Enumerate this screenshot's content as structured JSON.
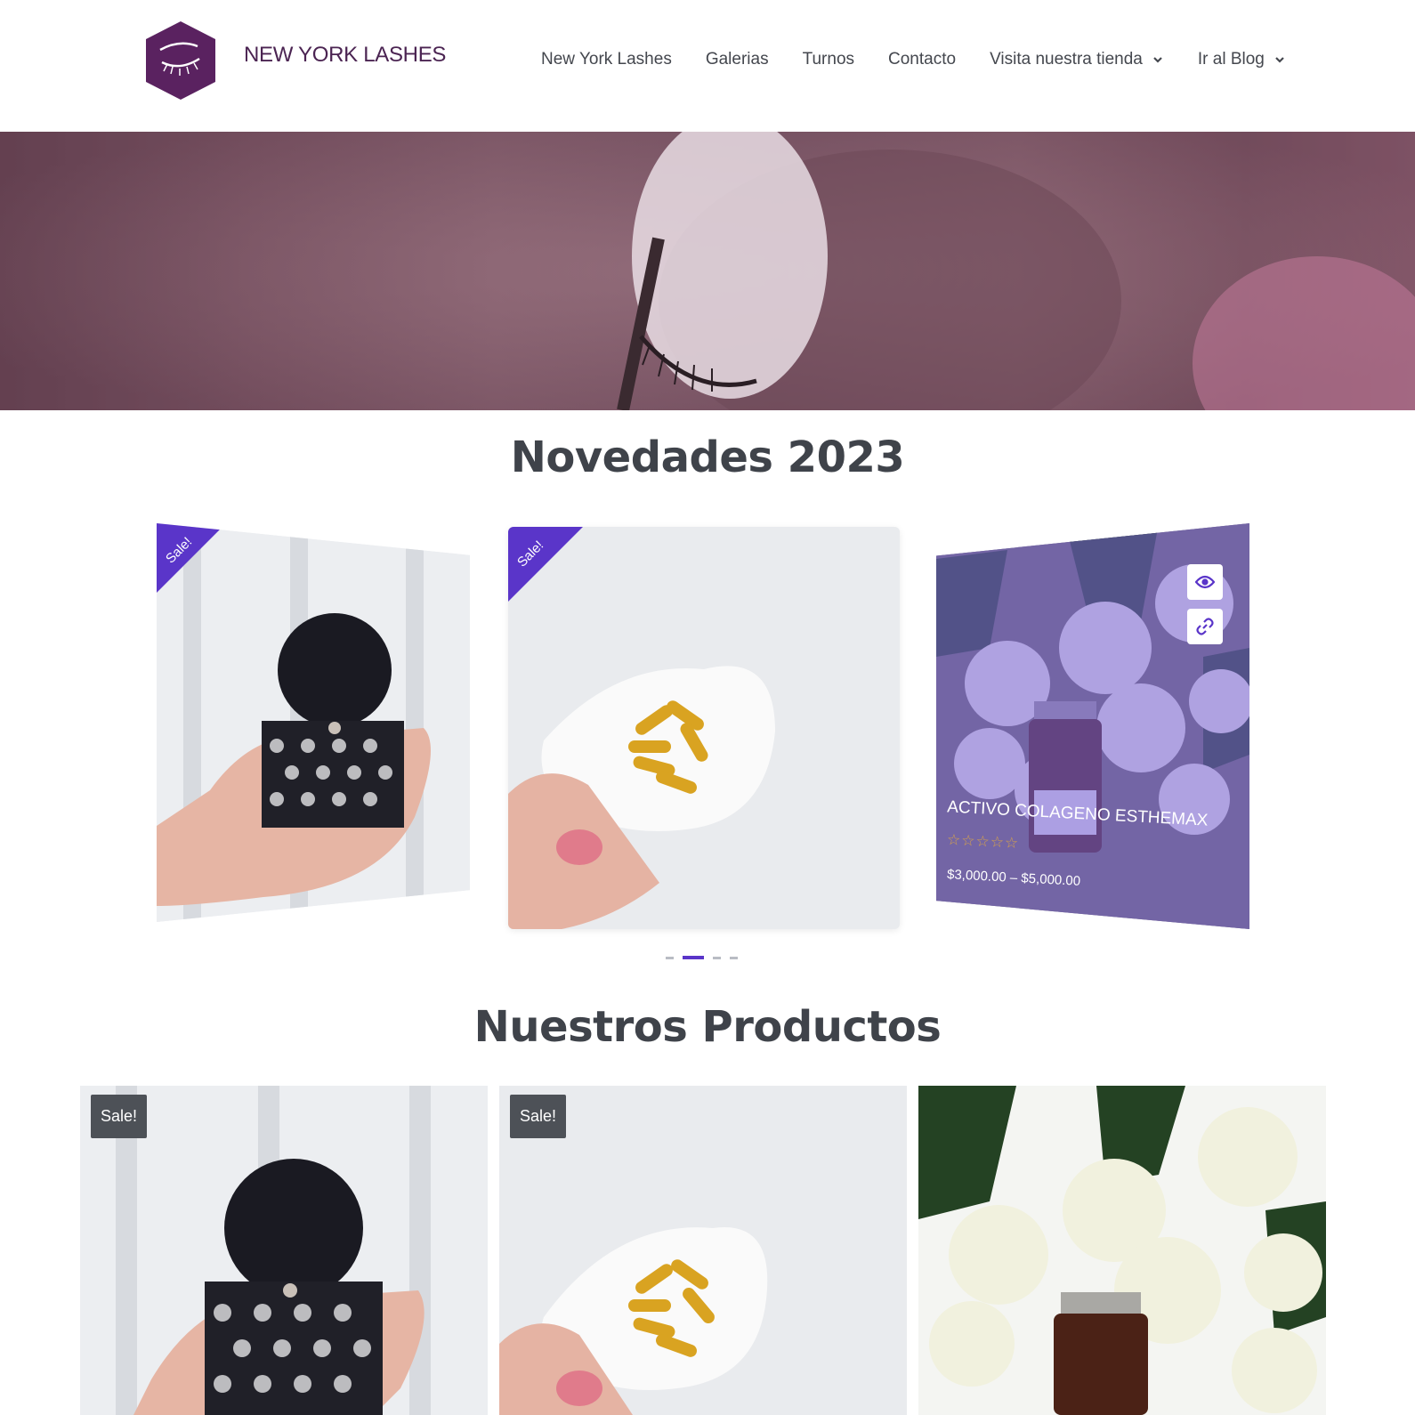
{
  "brand": {
    "name": "NEW YORK LASHES"
  },
  "nav": {
    "items": [
      {
        "label": "New York Lashes"
      },
      {
        "label": "Galerias"
      },
      {
        "label": "Turnos"
      },
      {
        "label": "Contacto"
      },
      {
        "label": "Visita nuestra tienda",
        "dropdown": true
      },
      {
        "label": "Ir al Blog",
        "dropdown": true
      }
    ]
  },
  "sections": {
    "novedades": {
      "title": "Novedades 2023"
    },
    "productos": {
      "title": "Nuestros Productos"
    }
  },
  "carousel": {
    "cards": [
      {
        "ribbon": "Sale!"
      },
      {
        "ribbon": "Sale!"
      },
      {
        "title": "ACTIVO COLAGENO ESTHEMAX",
        "rating": "☆☆☆☆☆",
        "price": "$3,000.00 – $5,000.00",
        "buttons": [
          "eye-icon",
          "link-icon"
        ]
      }
    ],
    "active_dot": 1,
    "dot_count": 4
  },
  "products": [
    {
      "badge": "Sale!"
    },
    {
      "badge": "Sale!"
    },
    {
      "badge": ""
    }
  ],
  "colors": {
    "accent": "#5a35c9",
    "brand": "#4b2452",
    "badge": "#4d5157",
    "stars": "#d7a24a"
  }
}
